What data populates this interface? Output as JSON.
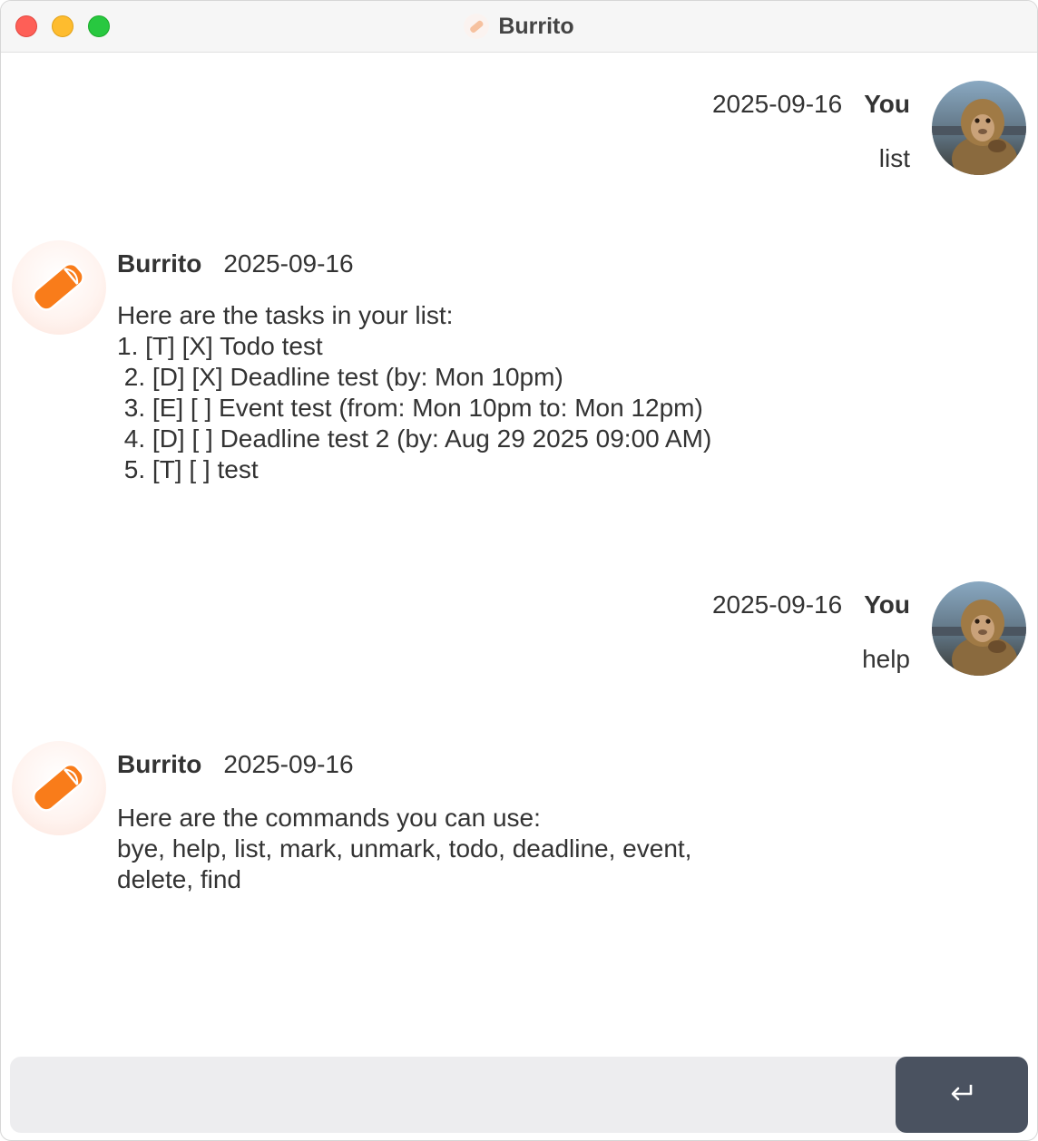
{
  "window": {
    "title": "Burrito"
  },
  "messages": [
    {
      "sender": "user",
      "date": "2025-09-16",
      "name": "You",
      "text": "list"
    },
    {
      "sender": "bot",
      "date": "2025-09-16",
      "name": "Burrito",
      "lines": [
        "Here are the tasks in your list:",
        "1. [T] [X] Todo test",
        " 2. [D] [X] Deadline test (by: Mon 10pm)",
        " 3. [E] [ ] Event test (from: Mon 10pm to: Mon 12pm)",
        " 4. [D] [ ] Deadline test 2 (by: Aug 29 2025 09:00 AM)",
        " 5. [T] [ ] test"
      ]
    },
    {
      "sender": "user",
      "date": "2025-09-16",
      "name": "You",
      "text": "help"
    },
    {
      "sender": "bot",
      "date": "2025-09-16",
      "name": "Burrito",
      "lines": [
        "Here are the commands you can use:",
        "bye, help, list, mark, unmark, todo, deadline, event,",
        "delete, find"
      ]
    }
  ],
  "input": {
    "value": "",
    "placeholder": ""
  },
  "send_button": {
    "icon": "return-icon"
  },
  "colors": {
    "accent_orange": "#f97c1a",
    "send_button_bg": "#4a5260",
    "input_bg": "#ededef"
  }
}
